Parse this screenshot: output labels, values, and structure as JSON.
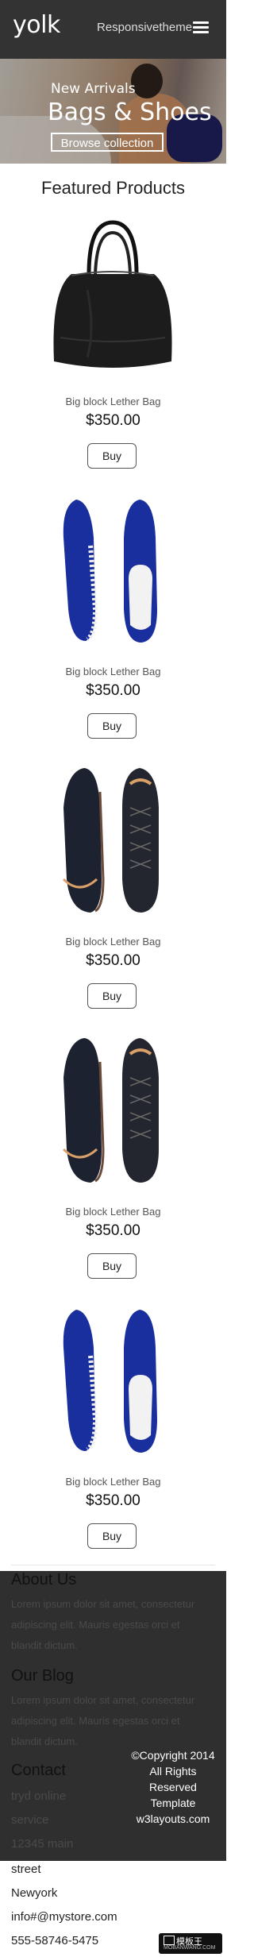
{
  "header": {
    "logo": "yolk",
    "brand": "Responsivetheme"
  },
  "hero": {
    "subtitle": "New Arrivals",
    "title": "Bags & Shoes",
    "cta": "Browse collection"
  },
  "featured_title": "Featured Products",
  "products": [
    {
      "name": "Big block Lether Bag",
      "price": "$350.00",
      "buy": "Buy"
    },
    {
      "name": "Big block Lether Bag",
      "price": "$350.00",
      "buy": "Buy"
    },
    {
      "name": "Big block Lether Bag",
      "price": "$350.00",
      "buy": "Buy"
    },
    {
      "name": "Big block Lether Bag",
      "price": "$350.00",
      "buy": "Buy"
    },
    {
      "name": "Big block Lether Bag",
      "price": "$350.00",
      "buy": "Buy"
    }
  ],
  "footer": {
    "about_title": "About Us",
    "about_text": "Lorem ipsum dolor sit amet, consectetur adipiscing elit. Mauris egestas orci et blandit dictum.",
    "blog_title": "Our Blog",
    "blog_text": "Lorem ipsum dolor sit amet, consectetur adipiscing elit. Mauris egestas orci et blandit dictum.",
    "contact_title": "Contact",
    "contact_lines": [
      "tryd online",
      "service",
      "12345 main",
      "street",
      "Newyork",
      "info#@mystore.com",
      "555-58746-5475"
    ],
    "copyright": "©Copyright 2014 All Rights Reserved Template w3layouts.com",
    "watermark": "模板王",
    "watermark_url": "MOBANWANG.COM"
  },
  "colors": {
    "header_bg": "#333333",
    "footer_bg": "#2f2f2f",
    "shoe_blue": "#1a2f9e"
  }
}
